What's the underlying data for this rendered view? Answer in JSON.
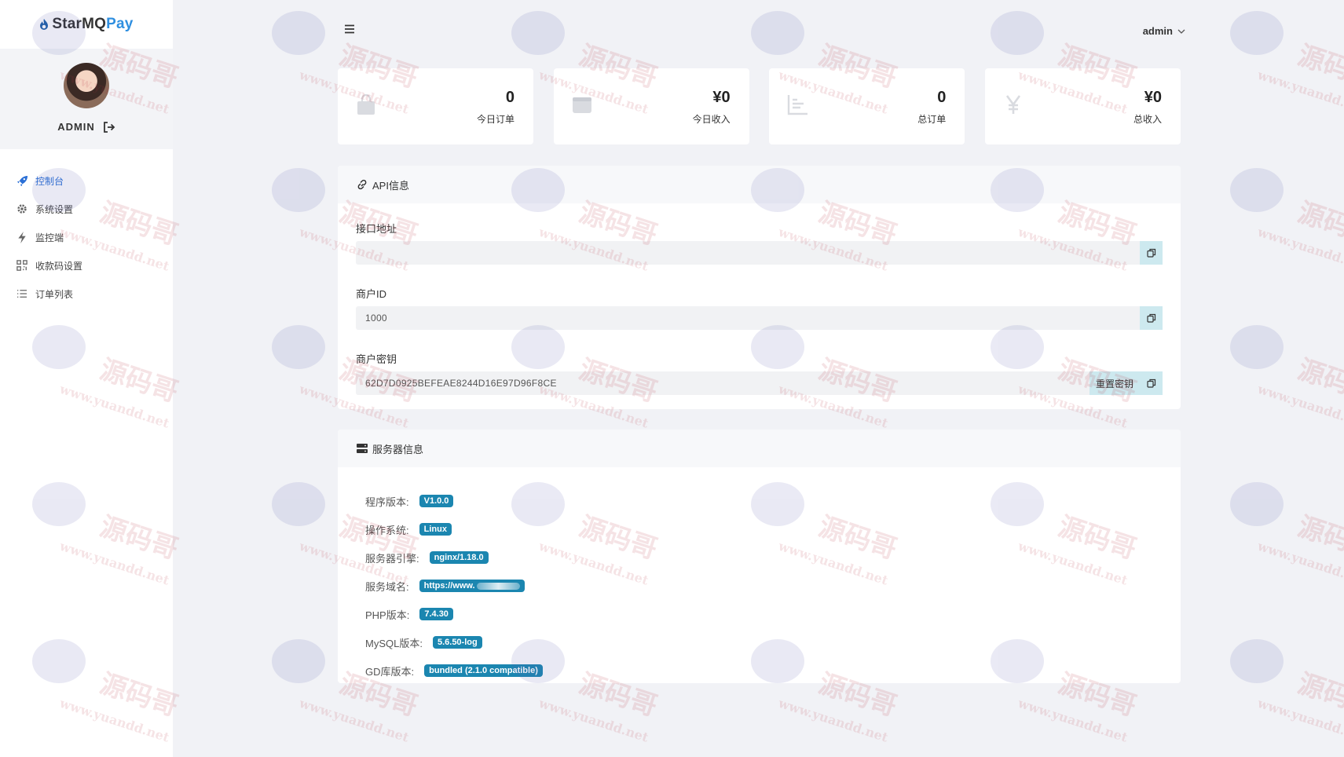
{
  "brand": {
    "name_part1": "StarMQ",
    "name_part2": "Pay",
    "accent": "#2f8fe0"
  },
  "profile": {
    "username": "ADMIN"
  },
  "nav": {
    "items": [
      {
        "label": "控制台",
        "icon": "rocket-icon",
        "active": true
      },
      {
        "label": "系统设置",
        "icon": "gear-icon"
      },
      {
        "label": "监控端",
        "icon": "bolt-icon"
      },
      {
        "label": "收款码设置",
        "icon": "qrcode-icon"
      },
      {
        "label": "订单列表",
        "icon": "list-icon"
      }
    ]
  },
  "topbar": {
    "user": "admin",
    "menu_icon": "hamburger-icon"
  },
  "stats": [
    {
      "value": "0",
      "label": "今日订单",
      "icon": "shopping-bag-icon"
    },
    {
      "value": "¥0",
      "label": "今日收入",
      "icon": "wallet-icon"
    },
    {
      "value": "0",
      "label": "总订单",
      "icon": "bar-chart-icon"
    },
    {
      "value": "¥0",
      "label": "总收入",
      "icon": "yen-icon"
    }
  ],
  "api": {
    "title": "API信息",
    "fields": [
      {
        "label": "接口地址",
        "value": ""
      },
      {
        "label": "商户ID",
        "value": "1000"
      },
      {
        "label": "商户密钥",
        "value": "62D7D0925BEFEAE8244D16E97D96F8CE"
      }
    ],
    "reset_label": "重置密钥"
  },
  "server": {
    "title": "服务器信息",
    "rows": [
      {
        "label": "程序版本:",
        "value": "V1.0.0"
      },
      {
        "label": "操作系统:",
        "value": "Linux"
      },
      {
        "label": "服务器引擎:",
        "value": "nginx/1.18.0"
      },
      {
        "label": "服务域名:",
        "value": "https://www."
      },
      {
        "label": "PHP版本:",
        "value": "7.4.30"
      },
      {
        "label": "MySQL版本:",
        "value": "5.6.50-log"
      },
      {
        "label": "GD库版本:",
        "value": "bundled (2.1.0 compatible)"
      }
    ],
    "badge_color": "#1b86b0"
  },
  "watermark": {
    "text": "源码哥",
    "url": "www.yuandd.net"
  }
}
